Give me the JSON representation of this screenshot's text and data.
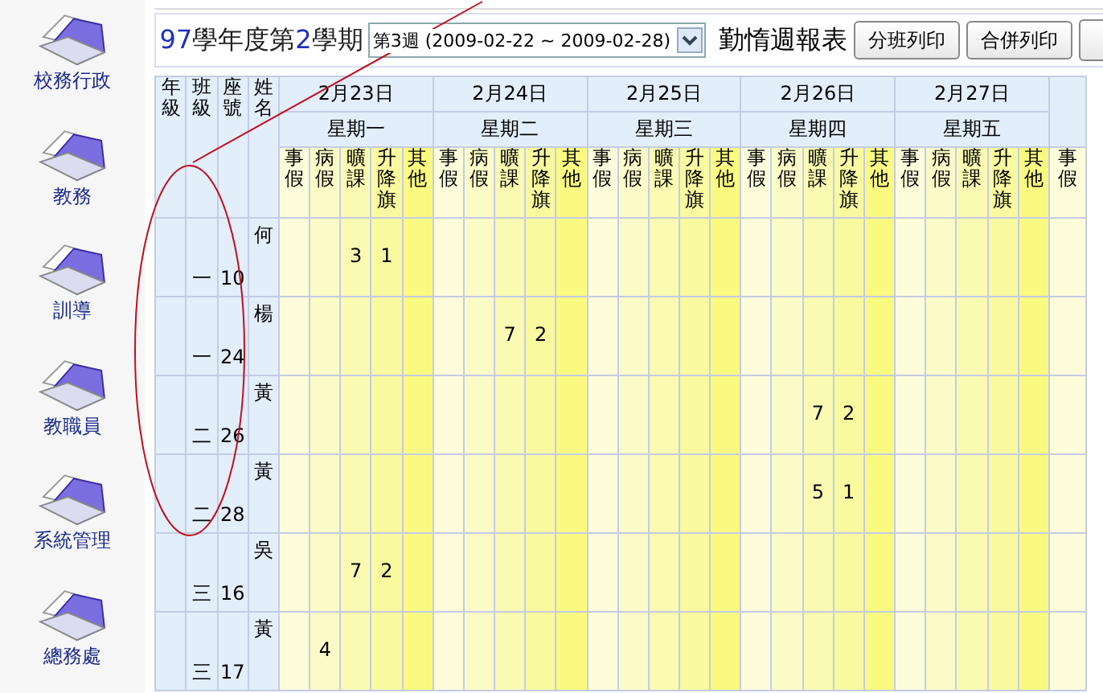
{
  "sidebar": {
    "items": [
      {
        "label": "校務行政"
      },
      {
        "label": "教務"
      },
      {
        "label": "訓導"
      },
      {
        "label": "教職員"
      },
      {
        "label": "系統管理"
      },
      {
        "label": "總務處"
      }
    ]
  },
  "toolbar": {
    "title": [
      {
        "text": "97",
        "kind": "number"
      },
      {
        "text": "學年度第",
        "kind": "text"
      },
      {
        "text": "2",
        "kind": "number"
      },
      {
        "text": "學期",
        "kind": "text"
      }
    ],
    "week_select": {
      "value": "第3週 (2009-02-22 ~ 2009-02-28)"
    },
    "report_title": "勤惰週報表",
    "buttons": [
      {
        "label": "分班列印"
      },
      {
        "label": "合併列印"
      }
    ]
  },
  "table": {
    "id_columns": [
      {
        "label": "年級"
      },
      {
        "label": "班級"
      },
      {
        "label": "座號"
      },
      {
        "label": "姓名"
      }
    ],
    "days": [
      {
        "date": "2月23日",
        "weekday": "星期一",
        "columns": [
          {
            "kind": "personal",
            "label": "事假"
          },
          {
            "kind": "sick",
            "label": "病假"
          },
          {
            "kind": "absent",
            "label": "曠課"
          },
          {
            "kind": "flag",
            "label": "升降旗"
          },
          {
            "kind": "other",
            "label": "其他"
          }
        ]
      },
      {
        "date": "2月24日",
        "weekday": "星期二",
        "columns": [
          {
            "kind": "personal",
            "label": "事假"
          },
          {
            "kind": "sick",
            "label": "病假"
          },
          {
            "kind": "absent",
            "label": "曠課"
          },
          {
            "kind": "flag",
            "label": "升降旗"
          },
          {
            "kind": "other",
            "label": "其他"
          }
        ]
      },
      {
        "date": "2月25日",
        "weekday": "星期三",
        "columns": [
          {
            "kind": "personal",
            "label": "事假"
          },
          {
            "kind": "sick",
            "label": "病假"
          },
          {
            "kind": "absent",
            "label": "曠課"
          },
          {
            "kind": "flag",
            "label": "升降旗"
          },
          {
            "kind": "other",
            "label": "其他"
          }
        ]
      },
      {
        "date": "2月26日",
        "weekday": "星期四",
        "columns": [
          {
            "kind": "personal",
            "label": "事假"
          },
          {
            "kind": "sick",
            "label": "病假"
          },
          {
            "kind": "absent",
            "label": "曠課"
          },
          {
            "kind": "flag",
            "label": "升降旗"
          },
          {
            "kind": "other",
            "label": "其他"
          }
        ]
      },
      {
        "date": "2月27日",
        "weekday": "星期五",
        "columns": [
          {
            "kind": "personal",
            "label": "事假"
          },
          {
            "kind": "sick",
            "label": "病假"
          },
          {
            "kind": "absent",
            "label": "曠課"
          },
          {
            "kind": "flag",
            "label": "升降旗"
          },
          {
            "kind": "other",
            "label": "其他"
          }
        ]
      }
    ],
    "partial_column": {
      "label": "事假"
    },
    "rows": [
      {
        "class": "一",
        "seat": "10",
        "name": "何",
        "by_day": {
          "day_1": {
            "absent": "3",
            "flag": "1"
          }
        }
      },
      {
        "class": "一",
        "seat": "24",
        "name": "楊",
        "by_day": {
          "day_2": {
            "absent": "7",
            "flag": "2"
          }
        }
      },
      {
        "class": "二",
        "seat": "26",
        "name": "黃",
        "by_day": {
          "day_4": {
            "absent": "7",
            "flag": "2"
          }
        }
      },
      {
        "class": "二",
        "seat": "28",
        "name": "黃",
        "by_day": {
          "day_4": {
            "absent": "5",
            "flag": "1"
          }
        }
      },
      {
        "class": "三",
        "seat": "16",
        "name": "吳",
        "by_day": {
          "day_1": {
            "absent": "7",
            "flag": "2"
          }
        }
      },
      {
        "class": "三",
        "seat": "17",
        "name": "黃",
        "by_day": {
          "day_1": {
            "sick": "4"
          }
        }
      }
    ]
  }
}
